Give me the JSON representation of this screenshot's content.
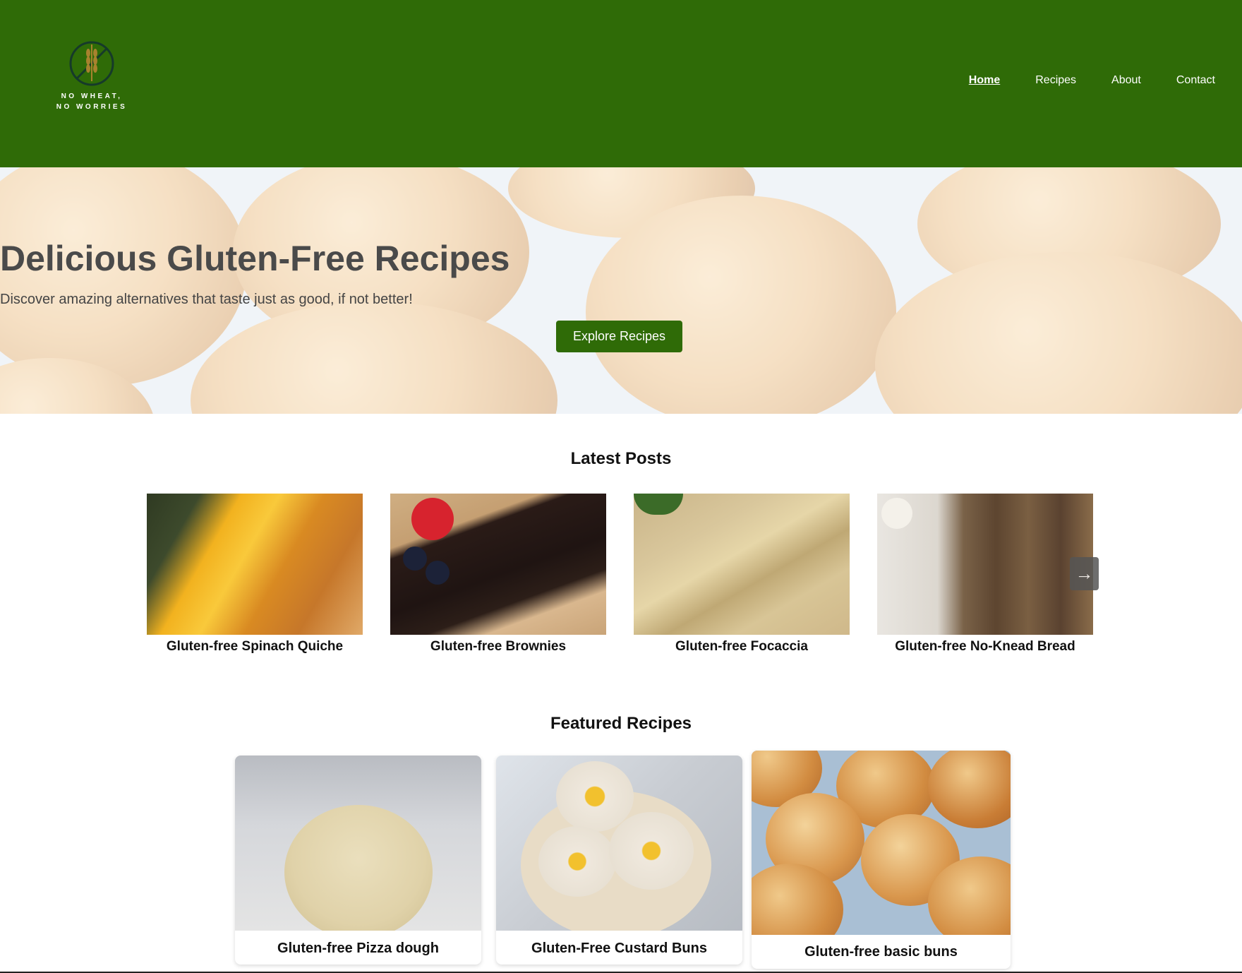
{
  "header": {
    "logo_text_1": "NO WHEAT,",
    "logo_text_2": "NO WORRIES",
    "nav": [
      "Home",
      "Recipes",
      "About",
      "Contact"
    ],
    "active_nav": "Home",
    "brand_color": "#2f6b07"
  },
  "hero": {
    "title": "Delicious Gluten-Free Recipes",
    "subtitle": "Discover amazing alternatives that taste just as good, if not better!",
    "button": "Explore Recipes"
  },
  "latest": {
    "title": "Latest Posts",
    "posts": [
      {
        "title": "Gluten-free Spinach Quiche"
      },
      {
        "title": "Gluten-free Brownies"
      },
      {
        "title": "Gluten-free Focaccia"
      },
      {
        "title": "Gluten-free No-Knead Bread"
      }
    ],
    "next_icon": "arrow-right-icon"
  },
  "featured": {
    "title": "Featured Recipes",
    "recipes": [
      {
        "title": "Gluten-free Pizza dough"
      },
      {
        "title": "Gluten-Free Custard Buns"
      },
      {
        "title": "Gluten-free basic buns"
      }
    ]
  }
}
